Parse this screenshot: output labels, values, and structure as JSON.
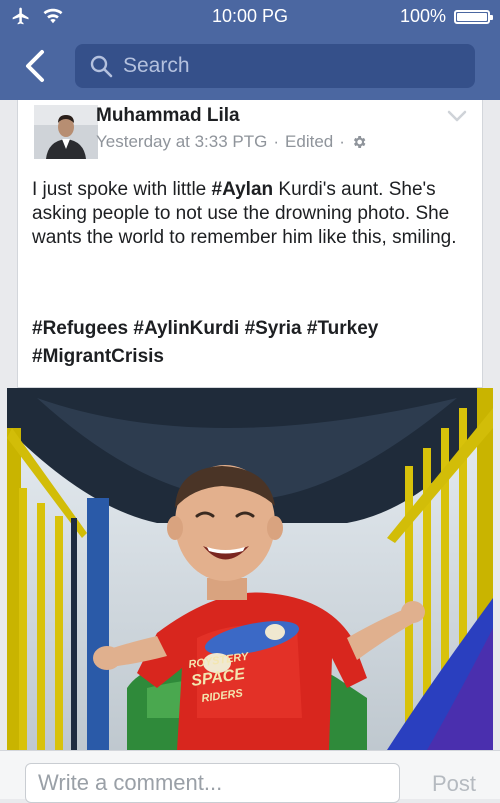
{
  "status_bar": {
    "time": "10:00 PG",
    "battery": "100%",
    "battery_level": 1.0,
    "icons": [
      "airplane-icon",
      "wifi-icon",
      "battery-icon"
    ]
  },
  "nav": {
    "search_placeholder": "Search",
    "back_icon": "chevron-left-icon",
    "search_icon": "magnifier-icon",
    "accent": "#4b67a1"
  },
  "post": {
    "author": "Muhammad Lila",
    "timestamp": "Yesterday at 3:33 PTG",
    "edited": "Edited",
    "separator": "·",
    "message_parts": [
      "I just spoke with little ",
      "#Aylan",
      " Kurdi's aunt. She's asking people to not use the drowning photo.  She wants the world to remember him like this, smiling."
    ],
    "hashtags_line1": "#Refugees #AylinKurdi #Syria #Turkey",
    "hashtags_line2": "#MigrantCrisis",
    "photo_shirt_text": [
      "ROYSTERY",
      "SPACE",
      "RIDERS"
    ]
  },
  "comment": {
    "placeholder": "Write a comment...",
    "post_label": "Post"
  }
}
